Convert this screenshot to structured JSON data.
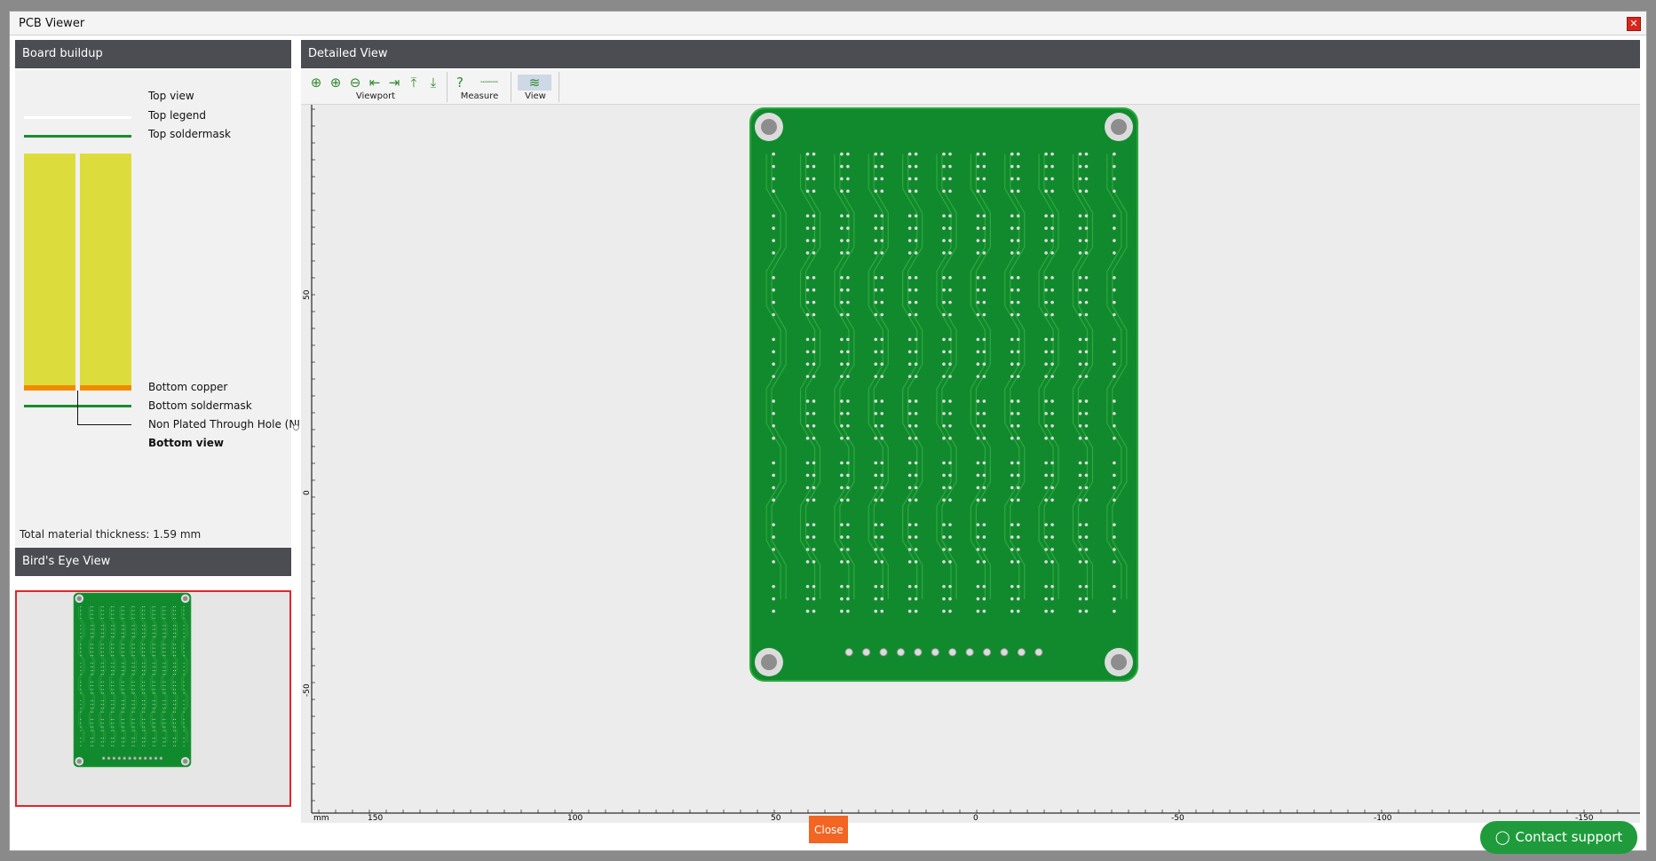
{
  "window": {
    "title": "PCB Viewer",
    "close_icon": "close-icon"
  },
  "buildup": {
    "header": "Board buildup",
    "labels": {
      "top_view": "Top view",
      "top_legend": "Top legend",
      "top_soldermask": "Top soldermask",
      "bottom_copper": "Bottom copper",
      "bottom_soldermask": "Bottom soldermask",
      "npth": "Non Plated Through Hole (NI",
      "bottom_view": "Bottom view"
    },
    "thickness": "Total material thickness: 1.59 mm",
    "colors": {
      "core": "#dcdc3c",
      "copper": "#f28a00",
      "soldermask": "#1a8c2e",
      "legend": "#ffffff"
    }
  },
  "birdseye": {
    "header": "Bird's Eye View"
  },
  "detailed": {
    "header": "Detailed View",
    "toolbar": {
      "groups": [
        {
          "label": "Viewport",
          "icons": [
            "zoom-fit-icon",
            "zoom-in-icon",
            "zoom-out-icon",
            "pan-left-icon",
            "pan-right-icon",
            "pan-up-icon",
            "pan-down-icon"
          ]
        },
        {
          "label": "Measure",
          "icons": [
            "help-icon",
            "measure-ruler-icon"
          ]
        },
        {
          "label": "View",
          "icons": [
            "view-layers-icon"
          ]
        }
      ]
    },
    "ruler": {
      "unit": "mm",
      "x_ticks": [
        "150",
        "100",
        "50",
        "0",
        "-50",
        "-100",
        "-150"
      ],
      "y_ticks": [
        "50",
        "0",
        "-50"
      ]
    }
  },
  "buttons": {
    "close": "Close",
    "support": "Contact support"
  },
  "colors": {
    "board": "#118a2e",
    "trace": "#2ea83e",
    "pad": "#dcdcdc",
    "hole": "#8d8d8d",
    "accent": "#f26522"
  }
}
